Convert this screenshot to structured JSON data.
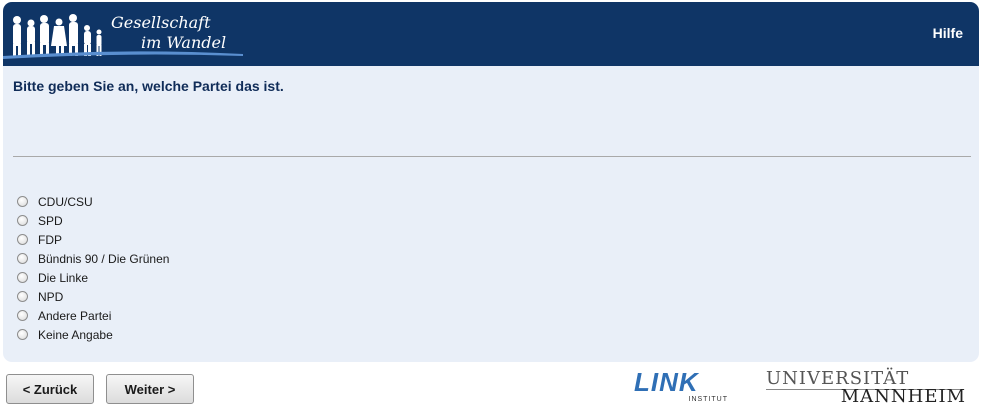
{
  "header": {
    "logo_line1": "Gesellschaft",
    "logo_line2": "im Wandel",
    "help_label": "Hilfe",
    "bg_color": "#0f3566"
  },
  "question": {
    "text": "Bitte geben Sie an, welche Partei das ist.",
    "options": [
      {
        "label": "CDU/CSU",
        "selected": false
      },
      {
        "label": "SPD",
        "selected": false
      },
      {
        "label": "FDP",
        "selected": false
      },
      {
        "label": "Bündnis 90 / Die Grünen",
        "selected": false
      },
      {
        "label": "Die Linke",
        "selected": false
      },
      {
        "label": "NPD",
        "selected": false
      },
      {
        "label": "Andere Partei",
        "selected": false
      },
      {
        "label": "Keine Angabe",
        "selected": false
      }
    ]
  },
  "nav": {
    "back_label": "< Zurück",
    "next_label": "Weiter >"
  },
  "footer": {
    "link_logo": "LINK",
    "link_sub": "INSTITUT",
    "uni_line1": "UNIVERSITÄT",
    "uni_line2": "MANNHEIM"
  }
}
